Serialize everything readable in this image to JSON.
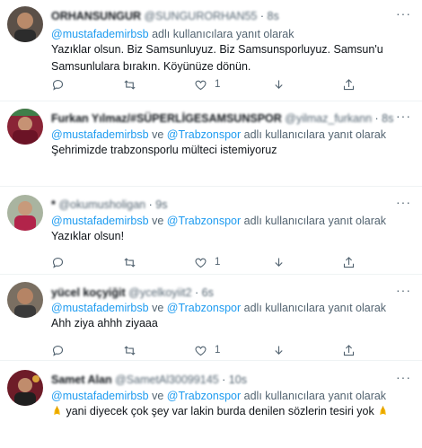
{
  "reply_connector": "ve",
  "reply_suffix": "adlı kullanıcılara yanıt olarak",
  "mention_1": "@mustafademirbsb",
  "mention_2": "@Trabzonspor",
  "separator": "·",
  "colors": {
    "link": "#1d9bf0",
    "secondary": "#536471",
    "text": "#0f1419"
  },
  "tweets": [
    {
      "name": "ORHANSUNGUR",
      "handle": "@SUNGURORHAN55",
      "time": "8s",
      "mentions": "@mustafademirbsb",
      "text": "Yazıklar olsun. Biz Samsunluyuz. Biz Samsunsporluyuz. Samsun'u Samsunlulara bırakın. Köyünüze dönün.",
      "like_count": "1"
    },
    {
      "name": "Furkan Yılmaz/#SÜPERLİGESAMSUNSPOR",
      "handle": "@yilmaz_furkann",
      "time": "8s",
      "text": "Şehrimizde trabzonsporlu mülteci istemiyoruz",
      "like_count": "1"
    },
    {
      "name": "*",
      "handle": "@okumusholigan",
      "time": "9s",
      "text": "Yazıklar olsun!",
      "like_count": "1"
    },
    {
      "name": "yücel koçyiğit",
      "handle": "@ycelkoyiit2",
      "time": "6s",
      "text": "Ahh ziya ahhh ziyaaa",
      "like_count": "1"
    },
    {
      "name": "Samet Alan",
      "handle": "@SametAl30099145",
      "time": "10s",
      "text_before": "yani diyecek çok şey var lakin burda denilen sözlerin tesiri yok",
      "emoji_left": "pray-hands-emoji",
      "emoji_right": "pray-hands-emoji"
    }
  ],
  "icons": [
    "reply-icon",
    "retweet-icon",
    "like-icon",
    "share-down-icon",
    "share-up-icon",
    "more-icon"
  ]
}
